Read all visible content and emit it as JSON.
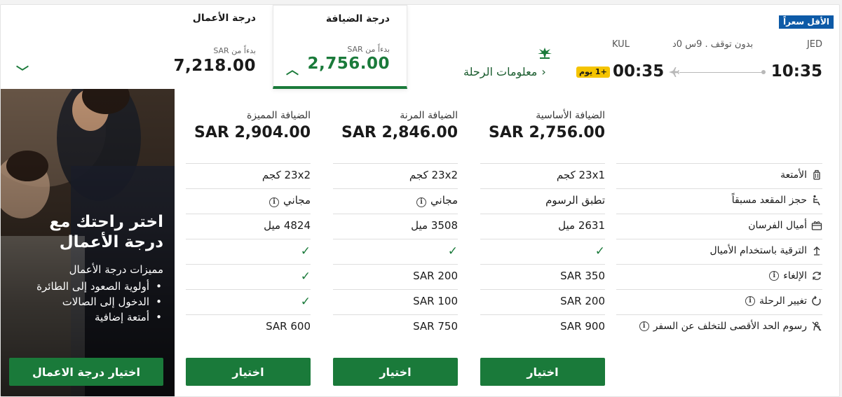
{
  "colors": {
    "brand_green": "#1a7a3a",
    "badge_blue": "#0d5aa7",
    "next_day_yellow": "#f5c400"
  },
  "flight": {
    "cheapest_badge": "الأقل سعراً",
    "origin_code": "JED",
    "destination_code": "KUL",
    "duration": "بدون توقف . 9س 0د",
    "departure_time": "10:35",
    "arrival_time": "00:35",
    "next_day": "+1 يوم",
    "flight_info_link": "معلومات الرحلة"
  },
  "cabins": {
    "economy": {
      "title": "درجة الضيافة",
      "from": "بدءاً من SAR",
      "price": "2,756.00",
      "selected": true
    },
    "business": {
      "title": "درجة الأعمال",
      "from": "بدءاً من SAR",
      "price": "7,218.00",
      "selected": false
    }
  },
  "promo": {
    "title": "اختر راحتك مع درجة الأعمال",
    "subtitle": "مميزات درجة الأعمال",
    "perks": [
      "أولوية الصعود إلى الطائرة",
      "الدخول إلى الصالات",
      "أمتعة إضافية"
    ],
    "button": "اختيار درجة الاعمال"
  },
  "fares": [
    {
      "name": "الضيافة الأساسية",
      "price": "SAR 2,756.00",
      "baggage": "23x1 كجم",
      "seat": "تطبق الرسوم",
      "miles": "2631 ميل",
      "upgrade": "check",
      "cancel": "SAR 350",
      "change": "SAR 200",
      "noshow": "SAR 900",
      "button": "اختيار"
    },
    {
      "name": "الضيافة المرنة",
      "price": "SAR 2,846.00",
      "baggage": "23x2 كجم",
      "seat": "مجاني",
      "miles": "3508 ميل",
      "upgrade": "check",
      "cancel": "SAR 200",
      "change": "SAR 100",
      "noshow": "SAR 750",
      "button": "اختيار"
    },
    {
      "name": "الضيافة المميزة",
      "price": "SAR 2,904.00",
      "baggage": "23x2 كجم",
      "seat": "مجاني",
      "miles": "4824 ميل",
      "upgrade": "check",
      "cancel": "check",
      "change": "check",
      "noshow": "SAR 600",
      "button": "اختيار"
    }
  ],
  "features": {
    "baggage": {
      "label": "الأمتعة",
      "icon": "luggage-icon"
    },
    "seat": {
      "label": "حجز المقعد مسبقاً",
      "icon": "seat-icon"
    },
    "miles": {
      "label": "أميال الفرسان",
      "icon": "gift-icon"
    },
    "upgrade": {
      "label": "الترقية باستخدام الأميال",
      "icon": "upgrade-arrow-icon"
    },
    "cancel": {
      "label": "الإلغاء",
      "icon": "refresh-icon",
      "info": "i"
    },
    "change": {
      "label": "تغيير الرحلة",
      "icon": "rotate-icon",
      "info": "i"
    },
    "noshow": {
      "label": "رسوم الحد الأقصى للتخلف عن السفر",
      "icon": "no-show-icon",
      "info": "i"
    }
  },
  "info_glyph": "i"
}
